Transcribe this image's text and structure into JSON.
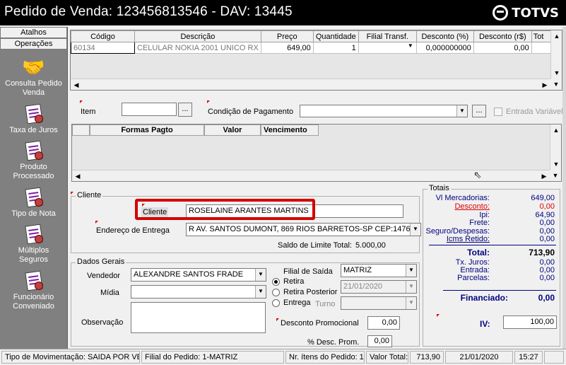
{
  "window": {
    "title": "Pedido de Venda: 123456813546  - DAV: 13445",
    "logo_text": "TOTVS"
  },
  "sidebar": {
    "tabs": [
      "Atalhos",
      "Operações"
    ],
    "items": [
      {
        "label": "Consulta Pedido Venda",
        "icon": "handshake-icon"
      },
      {
        "label": "Taxa de Juros",
        "icon": "document-seal-icon"
      },
      {
        "label": "Produto Processado",
        "icon": "document-seal-icon"
      },
      {
        "label": "Tipo de Nota",
        "icon": "document-seal-icon"
      },
      {
        "label": "Múltiplos Seguros",
        "icon": "document-seal-icon"
      },
      {
        "label": "Funcionário Conveniado",
        "icon": "document-seal-icon"
      }
    ]
  },
  "items_grid": {
    "headers": [
      "Código",
      "Descrição",
      "Preço",
      "Quantidade",
      "Filial Transf.",
      "Desconto (%)",
      "Desconto (r$)",
      "Tot"
    ],
    "rows": [
      [
        "60134",
        "CELULAR NOKIA 2001 UNICO  RX",
        "649,00",
        "1",
        "",
        "0,000000000",
        "0,00",
        ""
      ]
    ]
  },
  "payment": {
    "item_label": "Item",
    "item_value": "",
    "condicao_label": "Condição de Pagamento",
    "condicao_value": "",
    "entrada_variavel_label": "Entrada Variável",
    "ellipsis": "...",
    "grid_headers": [
      "Formas Pagto",
      "Valor",
      "Vencimento"
    ]
  },
  "cliente": {
    "group_title": "Cliente",
    "cliente_label": "Cliente",
    "cliente_value": "ROSELAINE ARANTES MARTINS",
    "endereco_label": "Endereço de Entrega",
    "endereco_value": "R  AV. SANTOS DUMONT, 869  RIOS BARRETOS-SP CEP:1476",
    "saldo_label": "Saldo de Limite Total:",
    "saldo_value": "5.000,00"
  },
  "dados_gerais": {
    "group_title": "Dados Gerais",
    "vendedor_label": "Vendedor",
    "vendedor_value": "ALEXANDRE SANTOS FRADE",
    "midia_label": "Mídia",
    "midia_value": "",
    "observacao_label": "Observação",
    "filial_saida_label": "Filial de Saída",
    "filial_saida_value": "MATRIZ",
    "retira_label": "Retira",
    "retira_posterior_label": "Retira Posterior",
    "retira_posterior_date": "21/01/2020",
    "entrega_label": "Entrega",
    "turno_label": "Turno",
    "desconto_promocional_label": "Desconto Promocional",
    "desconto_promocional_value": "0,00",
    "desc_prom_label": "% Desc. Prom.",
    "desc_prom_value": "0,00"
  },
  "totais": {
    "group_title": "Totais",
    "rows": [
      {
        "label": "Vl Mercadorias:",
        "value": "649,00"
      },
      {
        "label": "Desconto:",
        "value": "0,00"
      },
      {
        "label": "Ipi:",
        "value": "64,90"
      },
      {
        "label": "Frete:",
        "value": "0,00"
      },
      {
        "label": "Seguro/Despesas:",
        "value": "0,00"
      },
      {
        "label": "Icms Retido:",
        "value": "0,00"
      }
    ],
    "total_label": "Total:",
    "total_value": "713,90",
    "rows2": [
      {
        "label": "Tx. Juros:",
        "value": "0,00"
      },
      {
        "label": "Entrada:",
        "value": "0,00"
      },
      {
        "label": "Parcelas:",
        "value": "0,00"
      }
    ],
    "financiado_label": "Financiado:",
    "financiado_value": "0,00",
    "iv_label": "IV:",
    "iv_value": "100,00"
  },
  "statusbar": {
    "tipo_movimentacao": "Tipo de Movimentação: SAIDA POR VENDA",
    "filial_pedido": "Filial do Pedido: 1-MATRIZ",
    "nr_itens": "Nr. ítens do Pedido: 1",
    "valor_total_label": "Valor Total:",
    "valor_total": "713,90",
    "date": "21/01/2020",
    "time": "15:27"
  }
}
